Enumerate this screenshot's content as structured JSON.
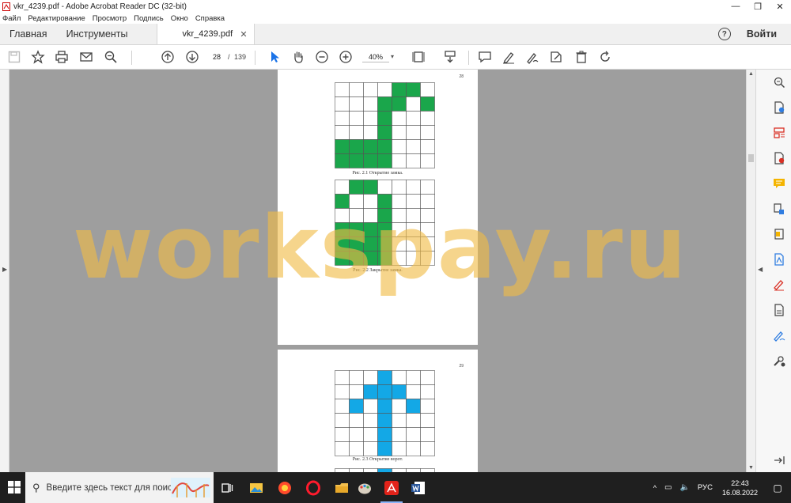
{
  "window": {
    "title": "vkr_4239.pdf - Adobe Acrobat Reader DC (32-bit)",
    "minimize": "—",
    "maximize": "❐",
    "close": "✕"
  },
  "menu": [
    "Файл",
    "Редактирование",
    "Просмотр",
    "Подпись",
    "Окно",
    "Справка"
  ],
  "tabs": {
    "home": "Главная",
    "tools": "Инструменты",
    "document": "vkr_4239.pdf",
    "close": "✕",
    "help": "?",
    "signin": "Войти"
  },
  "toolbar": {
    "current_page": "28",
    "separator": "/",
    "total_pages": "139",
    "zoom": "40%",
    "zoom_caret": "▾"
  },
  "document": {
    "page1_number": "28",
    "page2_number": "29",
    "fig1_caption": "Рис. 2.1 Открытие замка.",
    "fig2_caption": "Рис. 2.2 Закрытие замка.",
    "fig3_caption": "Рис. 2.3 Открытие ворот.",
    "watermark": "workspay.ru",
    "green": "#1aa64b",
    "blue": "#13a8e6"
  },
  "taskbar": {
    "search_placeholder": "Введите здесь текст для поиска",
    "tray_lang": "РУС",
    "time": "22:43",
    "date": "16.08.2022",
    "tray_chevron": "^",
    "sound": "🔈"
  }
}
